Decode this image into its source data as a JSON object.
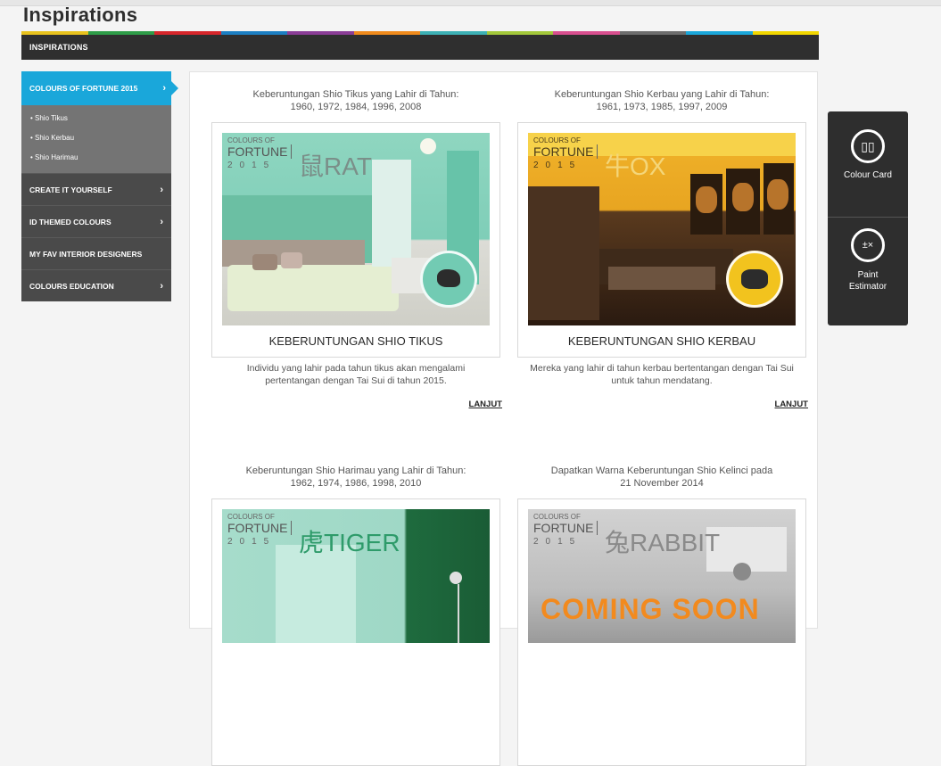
{
  "page": {
    "title": "Inspirations"
  },
  "section_bar": {
    "label": "INSPIRATIONS"
  },
  "strip_colors": [
    "#e8c21d",
    "#2e9d48",
    "#d7262b",
    "#1c7fc3",
    "#8b3d97",
    "#f08b1c",
    "#3db1b5",
    "#a3c83a",
    "#d94f8f",
    "#6d6d6d",
    "#1aa7da",
    "#f2d700"
  ],
  "sidebar": {
    "active": {
      "label": "COLOURS OF FORTUNE 2015",
      "chevron": "›"
    },
    "sub_items": [
      "• Shio Tikus",
      "• Shio Kerbau",
      "• Shio Harimau"
    ],
    "items": [
      {
        "label": "CREATE IT YOURSELF",
        "chevron": "›"
      },
      {
        "label": "ID THEMED COLOURS",
        "chevron": "›"
      },
      {
        "label": "MY FAV INTERIOR DESIGNERS",
        "chevron": ""
      },
      {
        "label": "COLOURS EDUCATION",
        "chevron": "›"
      }
    ]
  },
  "cards": [
    {
      "caption": "Keberuntungan Shio Tikus yang Lahir di Tahun:\n1960, 1972, 1984, 1996, 2008",
      "badge_top": "COLOURS OF",
      "badge_mid": "FORTUNE",
      "badge_year": "2015",
      "badge_animal": "鼠RAT",
      "title": "KEBERUNTUNGAN SHIO TIKUS",
      "description": "Individu yang lahir pada tahun tikus akan mengalami pertentangan dengan Tai Sui di tahun 2015.",
      "more": "LANJUT"
    },
    {
      "caption": "Keberuntungan Shio Kerbau yang Lahir di Tahun:\n1961, 1973, 1985, 1997, 2009",
      "badge_top": "COLOURS OF",
      "badge_mid": "FORTUNE",
      "badge_year": "2015",
      "badge_animal": "牛OX",
      "title": "KEBERUNTUNGAN SHIO KERBAU",
      "description": "Mereka yang lahir di tahun kerbau bertentangan dengan Tai Sui untuk tahun mendatang.",
      "more": "LANJUT"
    },
    {
      "caption": "Keberuntungan Shio Harimau yang Lahir di Tahun:\n1962, 1974, 1986, 1998, 2010",
      "badge_top": "COLOURS OF",
      "badge_mid": "FORTUNE",
      "badge_year": "2015",
      "badge_animal": "虎TIGER"
    },
    {
      "caption": "Dapatkan Warna Keberuntungan Shio Kelinci pada\n21 November 2014",
      "badge_top": "COLOURS OF",
      "badge_mid": "FORTUNE",
      "badge_year": "2015",
      "badge_animal": "兔RABBIT",
      "overlay": "COMING SOON"
    }
  ],
  "widget": {
    "colour_card": {
      "label": "Colour Card",
      "icon": "colour-card-icon"
    },
    "paint_estimator": {
      "label": "Paint Estimator",
      "icon": "calculator-icon"
    }
  }
}
